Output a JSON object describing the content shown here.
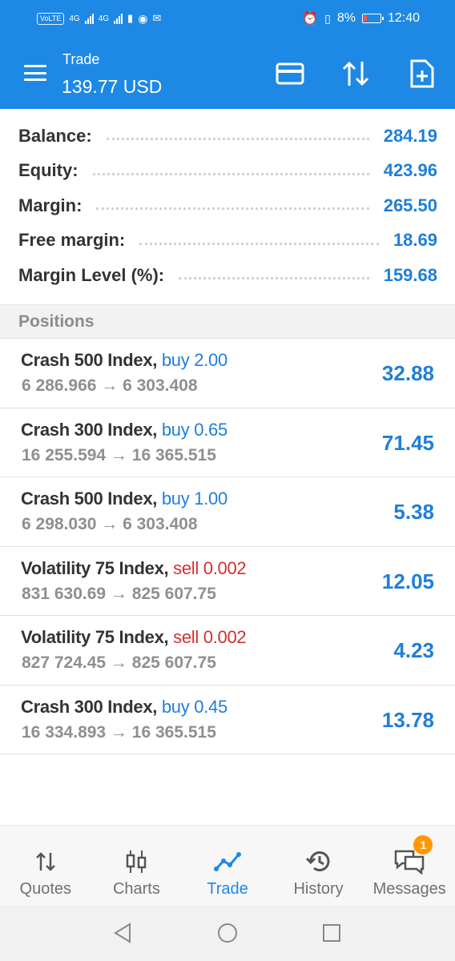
{
  "status_bar": {
    "left_chips": [
      "VoLTE",
      "4G",
      "4G"
    ],
    "battery": "8%",
    "time": "12:40"
  },
  "app_bar": {
    "title": "Trade",
    "subtitle": "139.77 USD",
    "icons": [
      "menu-icon",
      "card-icon",
      "sort-icon",
      "new-order-icon"
    ]
  },
  "summary": [
    {
      "label": "Balance:",
      "value": "284.19"
    },
    {
      "label": "Equity:",
      "value": "423.96"
    },
    {
      "label": "Margin:",
      "value": "265.50"
    },
    {
      "label": "Free margin:",
      "value": "18.69"
    },
    {
      "label": "Margin Level (%):",
      "value": "159.68"
    }
  ],
  "positions_header": "Positions",
  "positions": [
    {
      "symbol": "Crash 500 Index,",
      "type": "buy 2.00",
      "side": "buy",
      "prices": "6 286.966 → 6 303.408",
      "profit": "32.88"
    },
    {
      "symbol": "Crash 300 Index,",
      "type": "buy 0.65",
      "side": "buy",
      "prices": "16 255.594 → 16 365.515",
      "profit": "71.45"
    },
    {
      "symbol": "Crash 500 Index,",
      "type": "buy 1.00",
      "side": "buy",
      "prices": "6 298.030 → 6 303.408",
      "profit": "5.38"
    },
    {
      "symbol": "Volatility 75 Index,",
      "type": "sell 0.002",
      "side": "sell",
      "prices": "831 630.69 → 825 607.75",
      "profit": "12.05"
    },
    {
      "symbol": "Volatility 75 Index,",
      "type": "sell 0.002",
      "side": "sell",
      "prices": "827 724.45 → 825 607.75",
      "profit": "4.23"
    },
    {
      "symbol": "Crash 300 Index,",
      "type": "buy 0.45",
      "side": "buy",
      "prices": "16 334.893 → 16 365.515",
      "profit": "13.78"
    }
  ],
  "bottom_nav": [
    {
      "label": "Quotes",
      "icon": "quotes-icon",
      "active": false
    },
    {
      "label": "Charts",
      "icon": "charts-icon",
      "active": false
    },
    {
      "label": "Trade",
      "icon": "trade-icon",
      "active": true
    },
    {
      "label": "History",
      "icon": "history-icon",
      "active": false
    },
    {
      "label": "Messages",
      "icon": "messages-icon",
      "active": false,
      "badge": "1"
    }
  ],
  "colors": {
    "brand": "#1e88e5",
    "profit": "#1e7fd8",
    "sell": "#d32f2f",
    "badge": "#ff9800"
  }
}
